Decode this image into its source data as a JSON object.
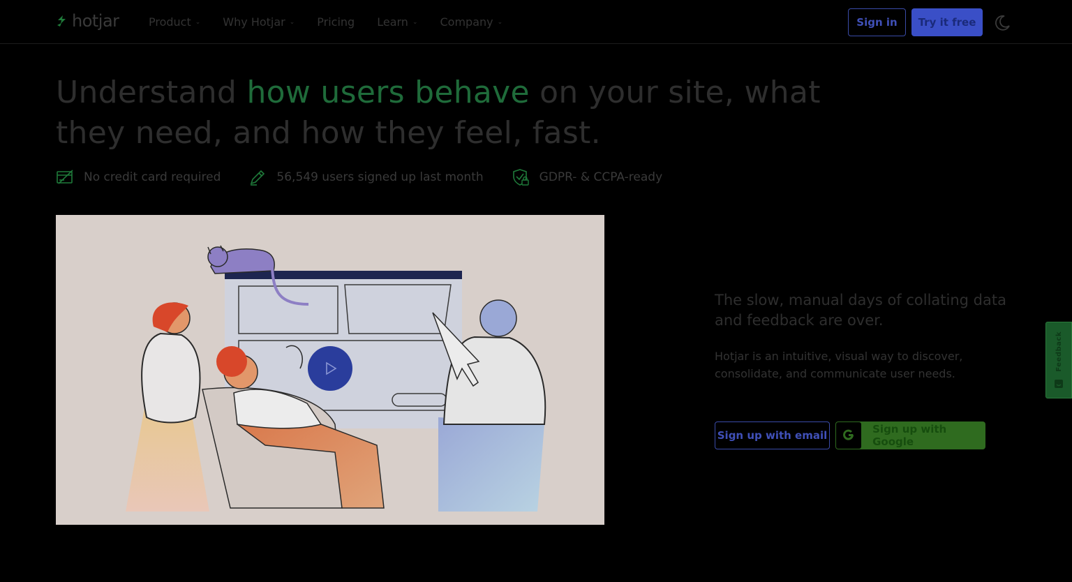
{
  "header": {
    "logo_text": "hotjar",
    "nav": [
      {
        "label": "Product",
        "has_dropdown": true
      },
      {
        "label": "Why Hotjar",
        "has_dropdown": true
      },
      {
        "label": "Pricing",
        "has_dropdown": false
      },
      {
        "label": "Learn",
        "has_dropdown": true
      },
      {
        "label": "Company",
        "has_dropdown": true
      }
    ],
    "signin_label": "Sign in",
    "try_label": "Try it free",
    "theme_icon": "moon-icon"
  },
  "hero": {
    "headline_pre": "Understand ",
    "headline_highlight": "how users behave",
    "headline_post": " on your site, what they need, and how they feel, fast.",
    "features": [
      {
        "icon": "credit-card-icon",
        "text": "No credit card required"
      },
      {
        "icon": "pencil-icon",
        "text": "56,549 users signed up last month"
      },
      {
        "icon": "shield-lock-icon",
        "text": "GDPR- & CCPA-ready"
      }
    ]
  },
  "right": {
    "subheading": "The slow, manual days of collating data and feedback are over.",
    "body": "Hotjar is an intuitive, visual way to discover, consolidate, and communicate user needs.",
    "email_btn": "Sign up with email",
    "google_btn": "Sign up with Google"
  },
  "feedback_tab": {
    "label": "Feedback"
  },
  "colors": {
    "accent_blue": "#3a4fc7",
    "highlight_green": "#1f6b3a",
    "google_green": "#2f6b1f",
    "illustration_bg": "#d8cfca"
  }
}
